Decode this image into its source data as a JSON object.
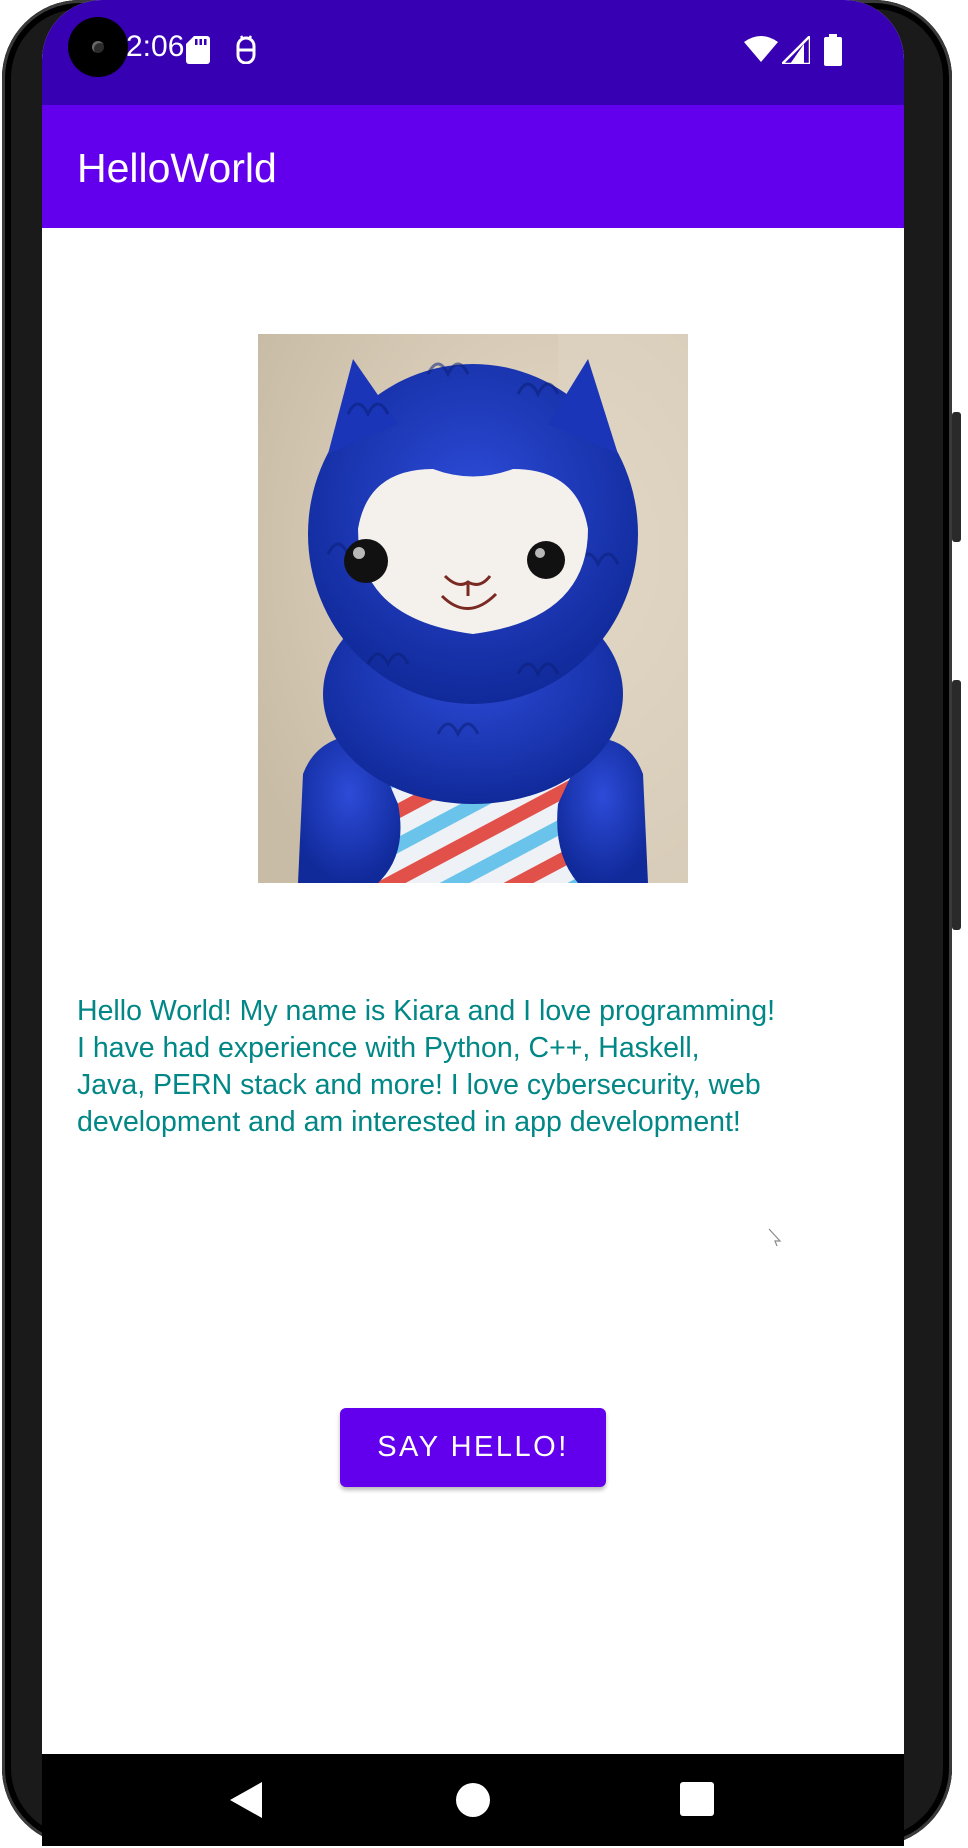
{
  "status_bar": {
    "time": "2:06",
    "icons": [
      "sd-card-icon",
      "android-debug-icon",
      "wifi-icon",
      "cellular-signal-icon",
      "battery-icon"
    ]
  },
  "app_bar": {
    "title": "HelloWorld"
  },
  "main": {
    "image_subject": "blue-alpaca-plush-photo",
    "intro_text": "Hello World! My name is Kiara and I love programming!\nI have had experience with Python, C++, Haskell,\nJava, PERN stack and more! I love cybersecurity, web\ndevelopment and am interested in app development!",
    "button_label": "SAY HELLO!"
  },
  "nav_bar": {
    "icons": [
      "back-icon",
      "home-icon",
      "recents-icon"
    ]
  },
  "colors": {
    "status_bar": "#3700b3",
    "app_bar": "#6200ee",
    "text_teal": "#018786",
    "button": "#6200ee"
  }
}
